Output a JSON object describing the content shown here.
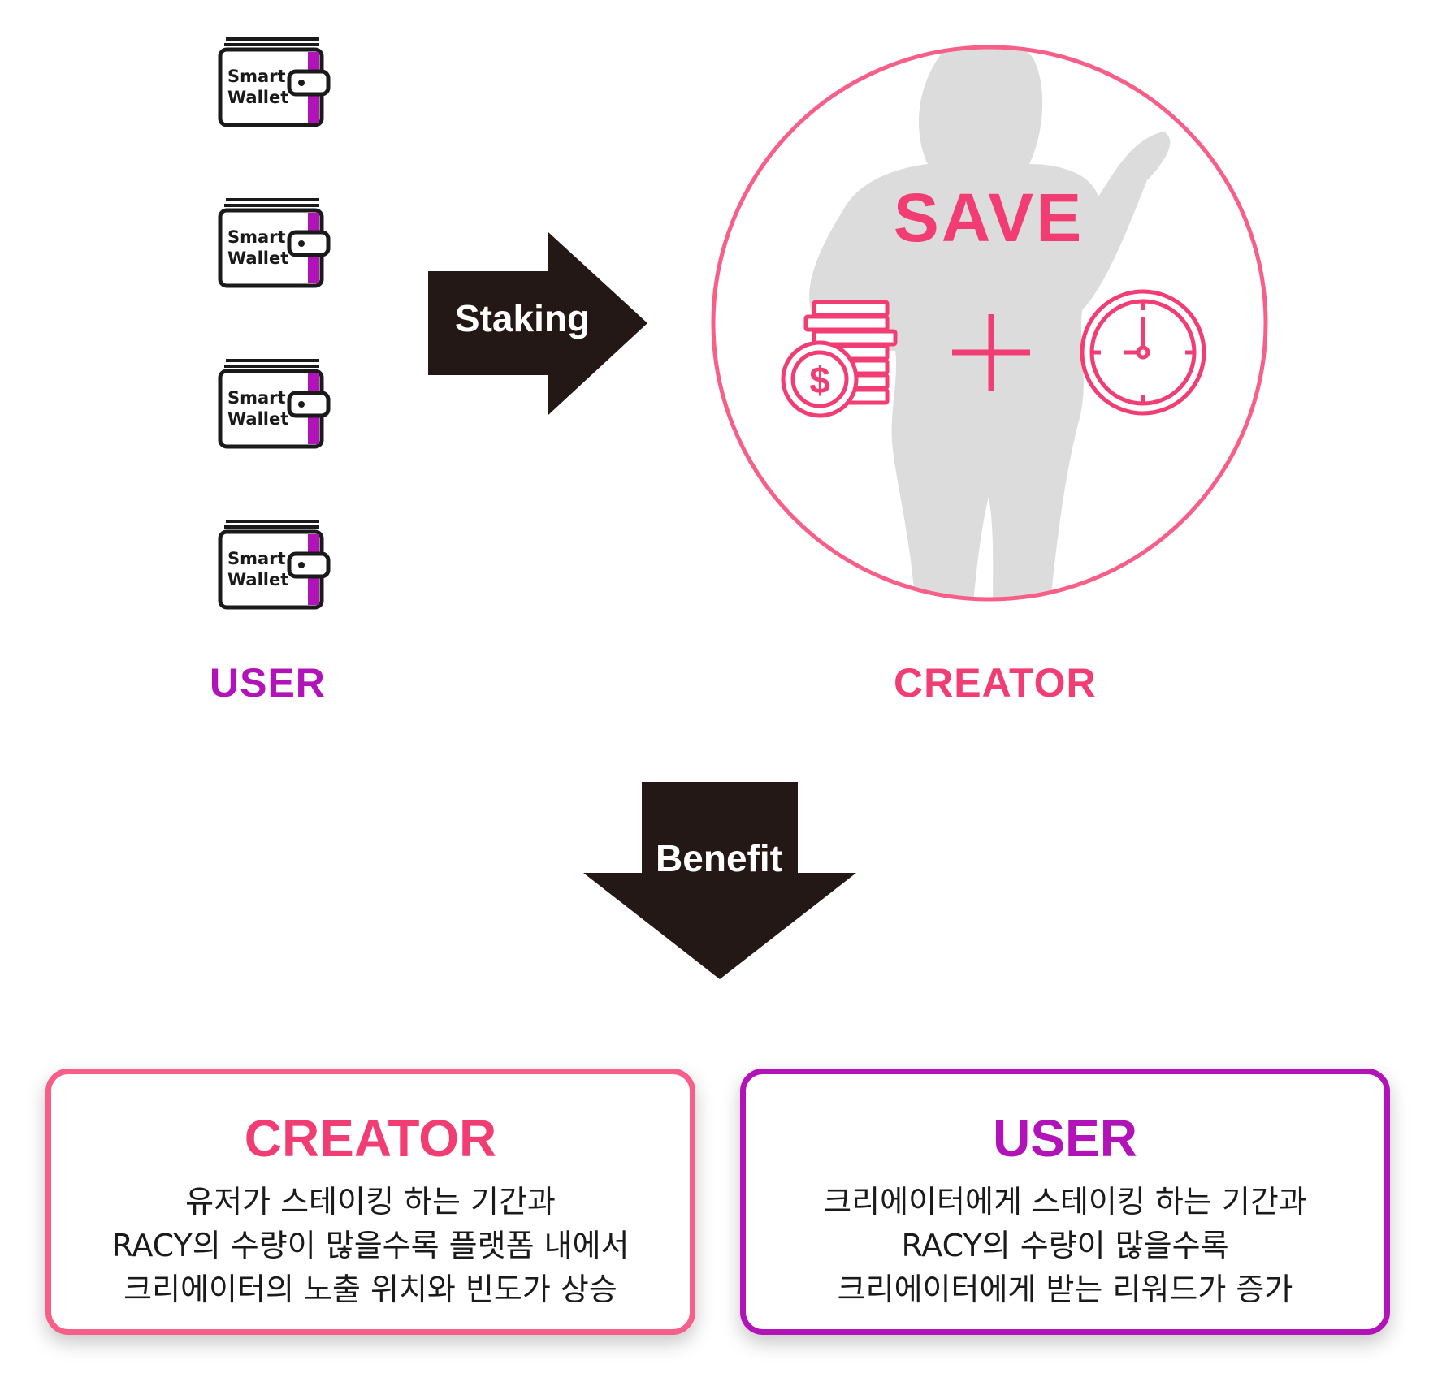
{
  "wallets": [
    {
      "line1": "Smart",
      "line2": "Wallet"
    },
    {
      "line1": "Smart",
      "line2": "Wallet"
    },
    {
      "line1": "Smart",
      "line2": "Wallet"
    },
    {
      "line1": "Smart",
      "line2": "Wallet"
    }
  ],
  "labels": {
    "user": "USER",
    "creator": "CREATOR"
  },
  "arrows": {
    "staking": "Staking",
    "benefit": "Benefit"
  },
  "circle": {
    "title": "SAVE",
    "icons": [
      "coins-dollar-icon",
      "plus-icon",
      "clock-icon"
    ]
  },
  "boxes": {
    "creator": {
      "title": "CREATOR",
      "lines": [
        "유저가 스테이킹 하는 기간과",
        "RACY의 수량이 많을수록 플랫폼 내에서",
        "크리에이터의 노출 위치와 빈도가 상승"
      ]
    },
    "user": {
      "title": "USER",
      "lines": [
        "크리에이터에게 스테이킹 하는 기간과",
        "RACY의 수량이 많을수록",
        "크리에이터에게 받는 리워드가 증가"
      ]
    }
  },
  "colors": {
    "pink": "#f23d74",
    "pink_border": "#f75e88",
    "purple": "#b213b9",
    "arrow": "#231815",
    "silhouette": "#dcdcdc"
  }
}
